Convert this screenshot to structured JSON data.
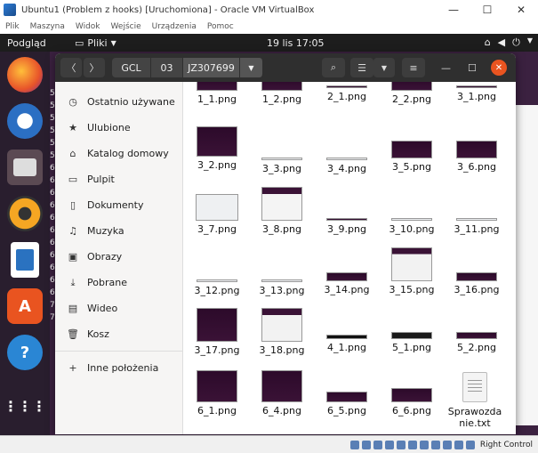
{
  "vbox": {
    "title": "Ubuntu1 (Problem z hooks) [Uruchomiona] - Oracle VM VirtualBox",
    "menu": [
      "Plik",
      "Maszyna",
      "Widok",
      "Wejście",
      "Urządzenia",
      "Pomoc"
    ],
    "status_right": "Right Control"
  },
  "topbar": {
    "activities": "Podgląd",
    "app": "Pliki",
    "clock": "19 lis  17:05"
  },
  "nautilus": {
    "path": [
      "GCL",
      "03",
      "JZ307699"
    ],
    "sidebar": [
      {
        "icon": "clock-icon",
        "glyph": "◷",
        "label": "Ostatnio używane"
      },
      {
        "icon": "star-icon",
        "glyph": "★",
        "label": "Ulubione"
      },
      {
        "icon": "home-icon",
        "glyph": "⌂",
        "label": "Katalog domowy"
      },
      {
        "icon": "desktop-icon",
        "glyph": "▭",
        "label": "Pulpit"
      },
      {
        "icon": "document-icon",
        "glyph": "▯",
        "label": "Dokumenty"
      },
      {
        "icon": "music-icon",
        "glyph": "♫",
        "label": "Muzyka"
      },
      {
        "icon": "image-icon",
        "glyph": "▣",
        "label": "Obrazy"
      },
      {
        "icon": "download-icon",
        "glyph": "⤓",
        "label": "Pobrane"
      },
      {
        "icon": "video-icon",
        "glyph": "▤",
        "label": "Wideo"
      },
      {
        "icon": "trash-icon",
        "glyph": "🗑",
        "label": "Kosz"
      },
      {
        "icon": "plus-icon",
        "glyph": "+",
        "label": "Inne położenia"
      }
    ],
    "files": [
      "1_1.png",
      "1_2.png",
      "2_1.png",
      "2_2.png",
      "3_1.png",
      "3_2.png",
      "3_3.png",
      "3_4.png",
      "3_5.png",
      "3_6.png",
      "3_7.png",
      "3_8.png",
      "3_9.png",
      "3_10.png",
      "3_11.png",
      "3_12.png",
      "3_13.png",
      "3_14.png",
      "3_15.png",
      "3_16.png",
      "3_17.png",
      "3_18.png",
      "4_1.png",
      "5_1.png",
      "5_2.png",
      "6_1.png",
      "6_4.png",
      "6_5.png",
      "6_6.png",
      "Sprawozdanie.txt"
    ]
  },
  "background_text": [
    "5",
    "5",
    "5",
    "5",
    "5",
    "5",
    "6",
    "6",
    "6",
    "6",
    "6",
    "6",
    "6",
    "6",
    "6",
    "6",
    "6",
    "7",
    "7"
  ]
}
